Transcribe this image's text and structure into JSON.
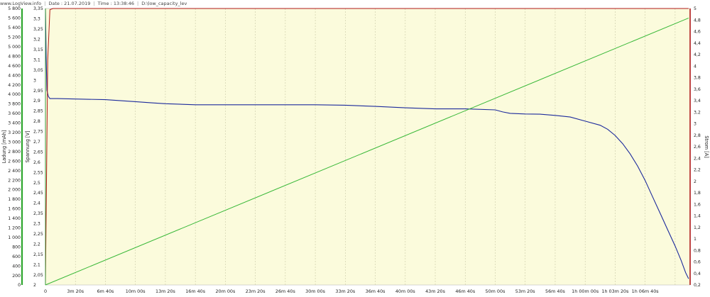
{
  "header": {
    "app": "www.LogView.info",
    "date": "Date : 21.07.2019",
    "time": "Time : 13:38:46",
    "file": "D:\\low_capacity_lev"
  },
  "chart_data": {
    "type": "line",
    "colors": {
      "plot_bg": "#fbfbdc",
      "grid": "#c9c9a6",
      "spannung": "#1c2a9c",
      "leistung": "#38b838",
      "strom": "#b01818",
      "ladung_axis": "#2ea62e",
      "spannung_axis": "#3b9b3b",
      "strom_axis": "#b01818"
    },
    "axes": {
      "ladung": {
        "label": "Ladung [mAh]",
        "ylim": [
          0,
          5800
        ],
        "ticks": [
          "0",
          "200",
          "400",
          "600",
          "800",
          "1 000",
          "1 200",
          "1 400",
          "1 600",
          "1 800",
          "2 000",
          "2 200",
          "2 400",
          "2 600",
          "2 800",
          "3 000",
          "3 200",
          "3 400",
          "3 600",
          "3 800",
          "4 000",
          "4 200",
          "4 400",
          "4 600",
          "4 800",
          "5 000",
          "5 200",
          "5 400",
          "5 600",
          "5 800"
        ]
      },
      "spannung": {
        "label": "Spannung [V]",
        "ylim": [
          2.0,
          3.35
        ],
        "ticks": [
          "2",
          "2,05",
          "2,1",
          "2,15",
          "2,2",
          "2,25",
          "2,3",
          "2,35",
          "2,4",
          "2,45",
          "2,5",
          "2,55",
          "2,6",
          "2,65",
          "2,7",
          "2,75",
          "2,8",
          "2,85",
          "2,9",
          "2,95",
          "3",
          "3,05",
          "3,1",
          "3,15",
          "3,2",
          "3,25",
          "3,3",
          "3,35"
        ]
      },
      "strom": {
        "label": "Strom [A]",
        "ylim": [
          0.2,
          5.0
        ],
        "ticks": [
          "0,2",
          "0,4",
          "0,6",
          "0,8",
          "1",
          "1,2",
          "1,4",
          "1,6",
          "1,8",
          "2",
          "2,2",
          "2,4",
          "2,6",
          "2,8",
          "3",
          "3,2",
          "3,4",
          "3,6",
          "3,8",
          "4",
          "4,2",
          "4,4",
          "4,6",
          "4,8",
          "5"
        ]
      },
      "x": {
        "xlim_s": [
          0,
          4300
        ],
        "tick_seconds": [
          0,
          200,
          400,
          600,
          800,
          1000,
          1200,
          1400,
          1600,
          1800,
          2000,
          2200,
          2400,
          2600,
          2800,
          3000,
          3200,
          3400,
          3600,
          3800,
          4000,
          4200
        ],
        "tick_labels": [
          "0",
          "3m 20s",
          "6m 40s",
          "10m 00s",
          "13m 20s",
          "16m 40s",
          "20m 00s",
          "23m 20s",
          "26m 40s",
          "30m 00s",
          "33m 20s",
          "36m 40s",
          "40m 00s",
          "43m 20s",
          "46m 40s",
          "50m 00s",
          "53m 20s",
          "56m 40s",
          "1h 00m 00s",
          "1h 03m 20s",
          "1h 06m 40s",
          ""
        ]
      }
    },
    "series": [
      {
        "key": "spannung",
        "axis": "spannung",
        "x": [
          0,
          5,
          10,
          20,
          30,
          40,
          80,
          400,
          600,
          700,
          800,
          1000,
          1200,
          1400,
          1600,
          1800,
          2000,
          2200,
          2400,
          2600,
          2700,
          2800,
          3000,
          3050,
          3100,
          3200,
          3300,
          3400,
          3500,
          3600,
          3700,
          3750,
          3800,
          3850,
          3900,
          3950,
          4000,
          4050,
          4100,
          4150,
          4200,
          4240,
          4270,
          4290
        ],
        "y": [
          3.35,
          3.1,
          2.95,
          2.92,
          2.91,
          2.91,
          2.91,
          2.905,
          2.895,
          2.89,
          2.885,
          2.88,
          2.88,
          2.88,
          2.88,
          2.88,
          2.878,
          2.872,
          2.865,
          2.86,
          2.86,
          2.86,
          2.855,
          2.845,
          2.838,
          2.835,
          2.834,
          2.828,
          2.82,
          2.8,
          2.78,
          2.76,
          2.73,
          2.69,
          2.64,
          2.58,
          2.51,
          2.43,
          2.35,
          2.27,
          2.19,
          2.12,
          2.06,
          2.03
        ]
      },
      {
        "key": "leistung",
        "axis": "ladung",
        "x": [
          0,
          4290
        ],
        "y": [
          0,
          5600
        ]
      },
      {
        "key": "strom",
        "axis": "strom",
        "x": [
          0,
          15,
          30,
          50,
          4290
        ],
        "y": [
          0.2,
          4.1,
          4.98,
          5.0,
          5.0
        ]
      }
    ]
  }
}
